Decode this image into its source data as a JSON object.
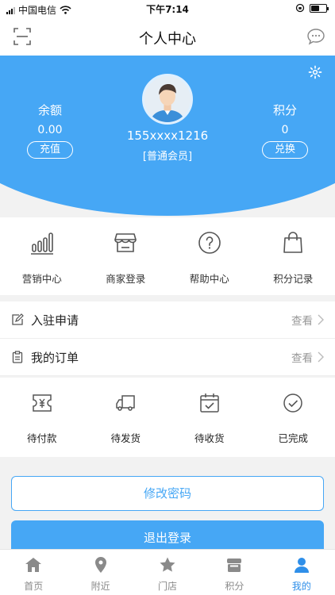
{
  "status_bar": {
    "carrier": "中国电信",
    "time": "下午7:14"
  },
  "nav": {
    "title": "个人中心",
    "left_icon": "scan-icon",
    "right_icon": "chat-bubble-icon"
  },
  "profile": {
    "balance_label": "余额",
    "balance_value": "0.00",
    "recharge_label": "充值",
    "points_label": "积分",
    "points_value": "0",
    "exchange_label": "兑换",
    "phone": "155xxxx1216",
    "member_level": "[普通会员]",
    "header_color": "#46a7f5"
  },
  "quick_menu": [
    {
      "label": "营销中心",
      "icon": "bar-chart-icon"
    },
    {
      "label": "商家登录",
      "icon": "storefront-icon"
    },
    {
      "label": "帮助中心",
      "icon": "question-circle-icon"
    },
    {
      "label": "积分记录",
      "icon": "shopping-bag-icon"
    }
  ],
  "rows": [
    {
      "label": "入驻申请",
      "action": "查看",
      "icon": "edit-note-icon"
    },
    {
      "label": "我的订单",
      "action": "查看",
      "icon": "clipboard-icon"
    }
  ],
  "order_status": [
    {
      "label": "待付款",
      "icon": "ticket-yen-icon"
    },
    {
      "label": "待发货",
      "icon": "truck-icon"
    },
    {
      "label": "待收货",
      "icon": "calendar-check-icon"
    },
    {
      "label": "已完成",
      "icon": "check-circle-icon"
    }
  ],
  "buttons": {
    "change_password": "修改密码",
    "logout": "退出登录"
  },
  "tabs": [
    {
      "label": "首页",
      "icon": "home-icon",
      "active": false
    },
    {
      "label": "附近",
      "icon": "location-pin-icon",
      "active": false
    },
    {
      "label": "门店",
      "icon": "star-icon",
      "active": false
    },
    {
      "label": "积分",
      "icon": "gift-box-icon",
      "active": false
    },
    {
      "label": "我的",
      "icon": "user-icon",
      "active": true
    }
  ],
  "colors": {
    "accent": "#46a7f5",
    "tab_active": "#2f8fe9",
    "tab_inactive": "#8a8a8a"
  }
}
